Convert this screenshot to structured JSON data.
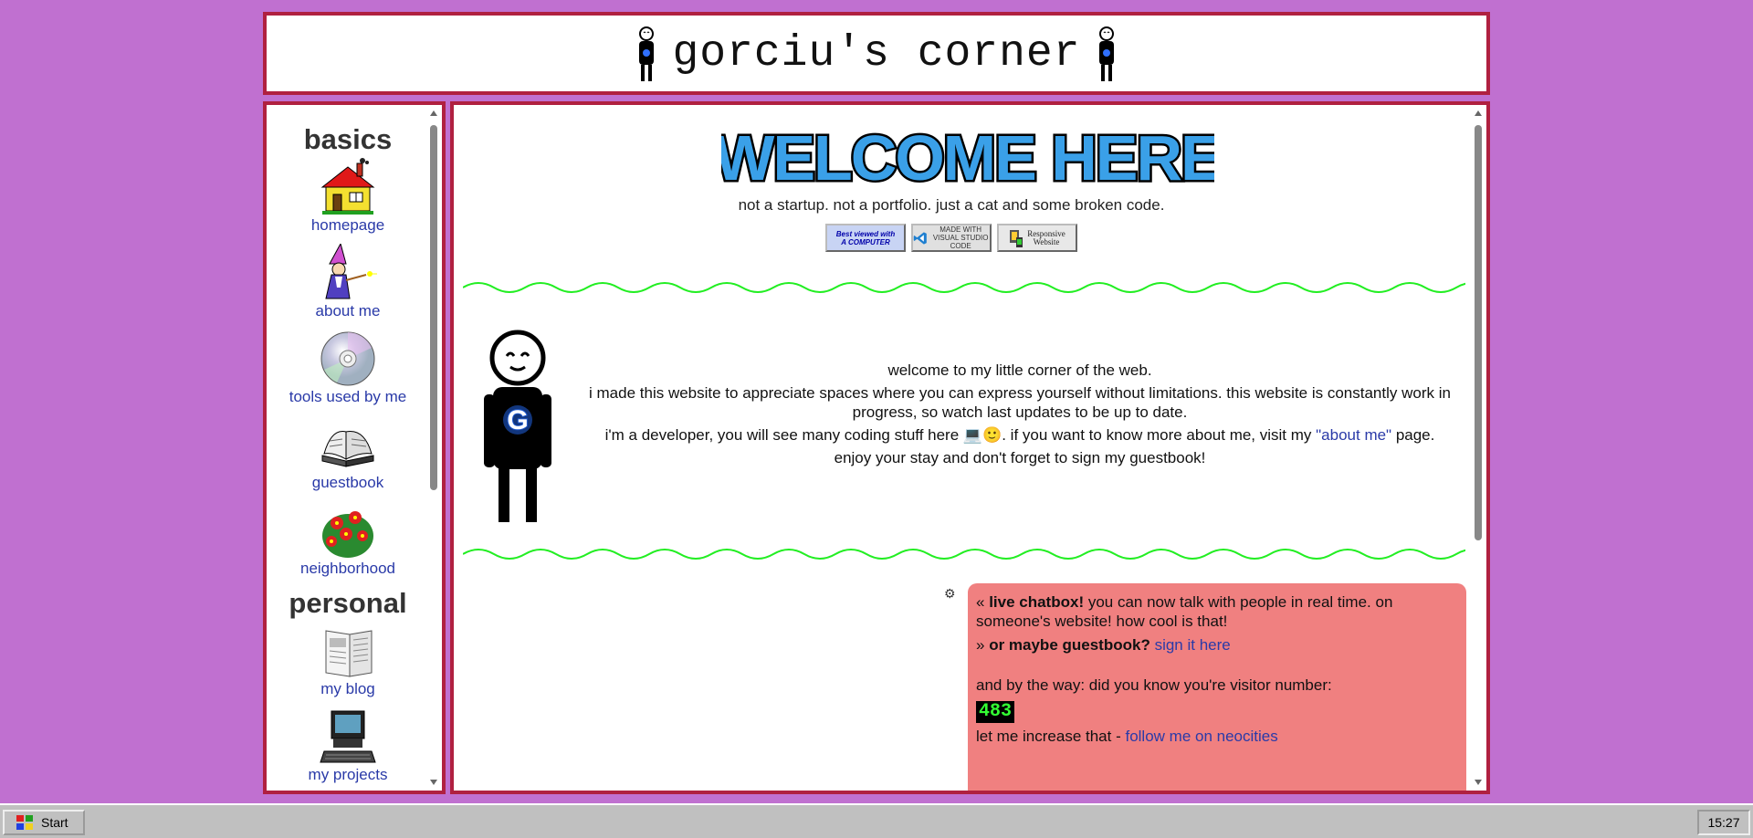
{
  "site_title": "gorciu's corner",
  "sidebar": {
    "sections": [
      {
        "title": "basics",
        "items": [
          {
            "label": "homepage",
            "icon": "house-icon"
          },
          {
            "label": "about me",
            "icon": "wizard-icon"
          },
          {
            "label": "tools used by me",
            "icon": "cd-icon"
          },
          {
            "label": "guestbook",
            "icon": "book-icon"
          },
          {
            "label": "neighborhood",
            "icon": "flowers-icon"
          }
        ]
      },
      {
        "title": "personal",
        "items": [
          {
            "label": "my blog",
            "icon": "newspaper-icon"
          },
          {
            "label": "my projects",
            "icon": "computer-icon"
          },
          {
            "label": "",
            "icon": "heart-icon"
          }
        ]
      }
    ]
  },
  "main": {
    "banner_text": "WELCOME HERE",
    "tagline": "not a startup. not a portfolio. just a cat and some broken code.",
    "badges": [
      {
        "text_top": "Best viewed with",
        "text_bottom": "A COMPUTER"
      },
      {
        "text_top": "MADE WITH",
        "text_bottom": "VISUAL STUDIO CODE"
      },
      {
        "text_top": "Responsive",
        "text_bottom": "Website"
      }
    ],
    "avatar_letter": "G",
    "intro": {
      "line1": "welcome to my little corner of the web.",
      "line2": "i made this website to appreciate spaces where you can express yourself without limitations. this website is constantly work in progress, so watch last updates to be up to date.",
      "line3_before": "i'm a developer, you will see many coding stuff here 💻🙂. if you want to know more about me, visit my ",
      "line3_link": "\"about me\"",
      "line3_after": " page.",
      "line4": "enjoy your stay and don't forget to sign my guestbook!"
    },
    "chatbox": {
      "line1_prefix": "« ",
      "line1_bold": "live chatbox!",
      "line1_rest": " you can now talk with people in real time. on someone's website! how cool is that!",
      "line2_prefix": "» ",
      "line2_bold": "or maybe guestbook?",
      "line2_link": "sign it here",
      "visitor_text": "and by the way: did you know you're visitor number:",
      "visitor_count": "483",
      "increase_text": "let me increase that - ",
      "increase_link": "follow me on neocities"
    }
  },
  "taskbar": {
    "start_label": "Start",
    "clock": "15:27"
  },
  "colors": {
    "background": "#c070d0",
    "frame_border": "#b02040",
    "link": "#2a3aa8",
    "chatbox": "#f08080",
    "wave": "#22ee22"
  }
}
